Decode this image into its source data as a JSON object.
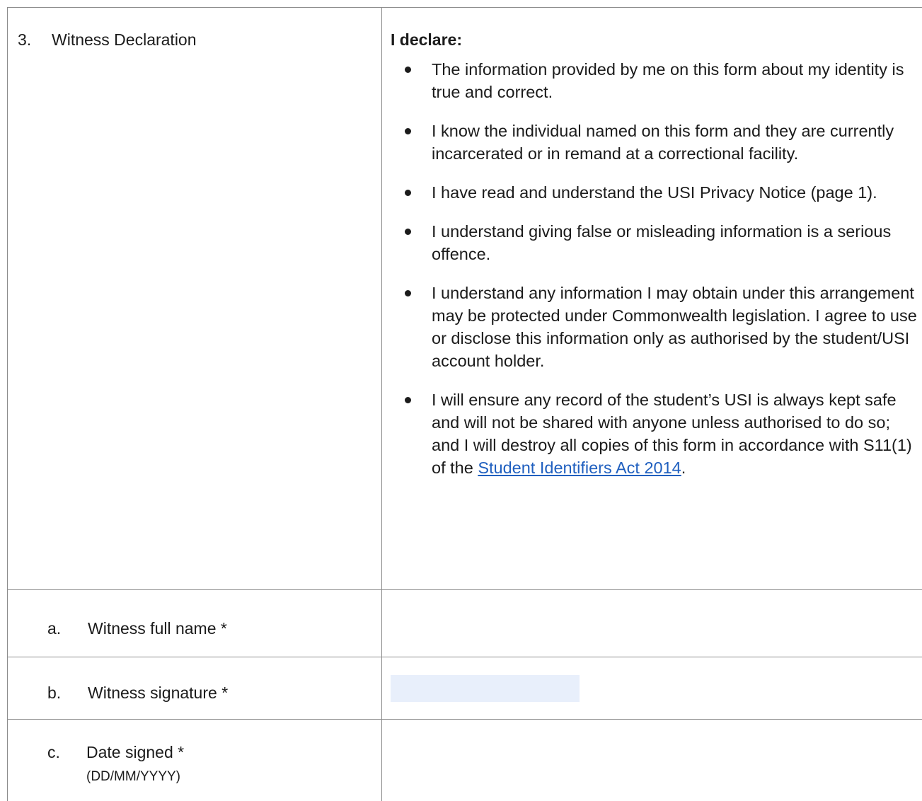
{
  "section": {
    "number": "3.",
    "title": "Witness Declaration"
  },
  "declaration": {
    "heading": "I declare:",
    "items": [
      {
        "text": "The information provided by me on this form about my identity is true and correct."
      },
      {
        "text": "I know the individual named on this form and they are currently incarcerated or in remand at a correctional facility."
      },
      {
        "text": "I have read and understand the USI Privacy Notice (page 1)."
      },
      {
        "text": "I understand giving false or misleading information is a serious offence."
      },
      {
        "text": "I understand any information I may obtain under this arrangement may be protected under Commonwealth legislation. I agree to use or disclose this information only as authorised by the student/USI account holder."
      },
      {
        "text_before": "I will ensure any record of the student’s USI is always kept safe and will not be shared with anyone unless authorised to do so; and I will destroy all copies of this form in accordance with S11(1) of the",
        "link_text": "Student Identifiers Act 2014",
        "text_after": "."
      }
    ]
  },
  "fields": {
    "full_name": {
      "letter": "a.",
      "label": "Witness full name *",
      "value": ""
    },
    "signature": {
      "letter": "b.",
      "label": "Witness signature *",
      "value": ""
    },
    "date_signed": {
      "letter": "c.",
      "label": "Date signed *",
      "hint": "(DD/MM/YYYY)",
      "value": ""
    }
  },
  "colors": {
    "border": "#8c8c8c",
    "link": "#1f5fbf",
    "signature_fill": "#e8effb"
  }
}
